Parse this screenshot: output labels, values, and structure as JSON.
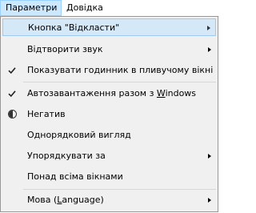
{
  "menubar": {
    "params_label": "Параметри",
    "help_label": "Довідка"
  },
  "menu": {
    "snooze_button": {
      "label": "Кнопка \"Відкласти\"",
      "has_submenu": true,
      "highlighted": true
    },
    "play_sound": {
      "label": "Відтворити звук",
      "has_submenu": true
    },
    "show_clock_float": {
      "label": "Показувати годинник в пливучому вікні",
      "checked": true
    },
    "autostart_before": "Автозавантаження разом з ",
    "autostart_underline": "W",
    "autostart_after": "indows",
    "autostart_checked": true,
    "negative": {
      "label": "Негатив",
      "icon": "contrast-icon"
    },
    "uniform_look": {
      "label": "Однорядковий вигляд"
    },
    "arrange": {
      "label": "Упорядкувати за",
      "has_submenu": true
    },
    "always_on_top": {
      "label": "Понад всіма вікнами"
    },
    "language_before": "Мова (",
    "language_underline": "L",
    "language_after": "anguage)",
    "language_has_submenu": true
  },
  "colors": {
    "highlight_bg": "#d5e8f8",
    "highlight_border": "#9ccaf0",
    "menu_bg": "#f0f0f0",
    "menubar_open_bg": "#cce8ff"
  }
}
